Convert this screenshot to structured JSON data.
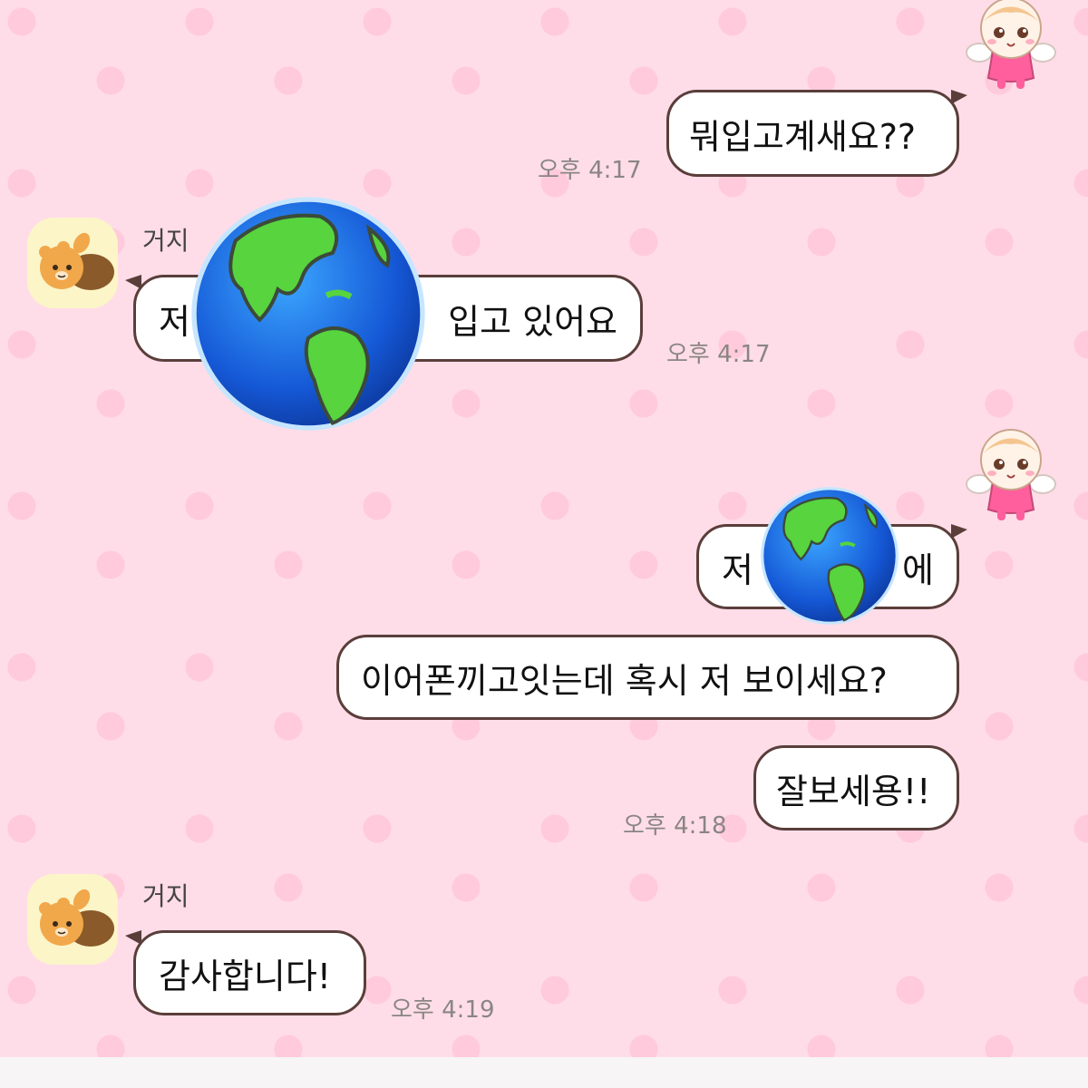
{
  "messages": [
    {
      "text": "뭐입고계새요??",
      "time": "오후 4:17"
    },
    {
      "sender": "거지",
      "text_start": "저",
      "text_end": "입고 있어요",
      "time": "오후 4:17"
    },
    {
      "text_start": "저",
      "text_end": "에"
    },
    {
      "text": "이어폰끼고잇는데 혹시 저 보이세요?"
    },
    {
      "text": "잘보세용!!",
      "time": "오후 4:18"
    },
    {
      "sender": "거지",
      "text": "감사합니다!",
      "time": "오후 4:19"
    }
  ],
  "colors": {
    "background": "#ffdde8",
    "dot": "#ffcadb",
    "bubble_border": "#5a3e3a",
    "time_text": "#8a8585"
  },
  "icons": {
    "sender_profile": "lion-character-icon",
    "own_profile": "angel-character-icon",
    "sticker": "globe-emoji-icon"
  }
}
